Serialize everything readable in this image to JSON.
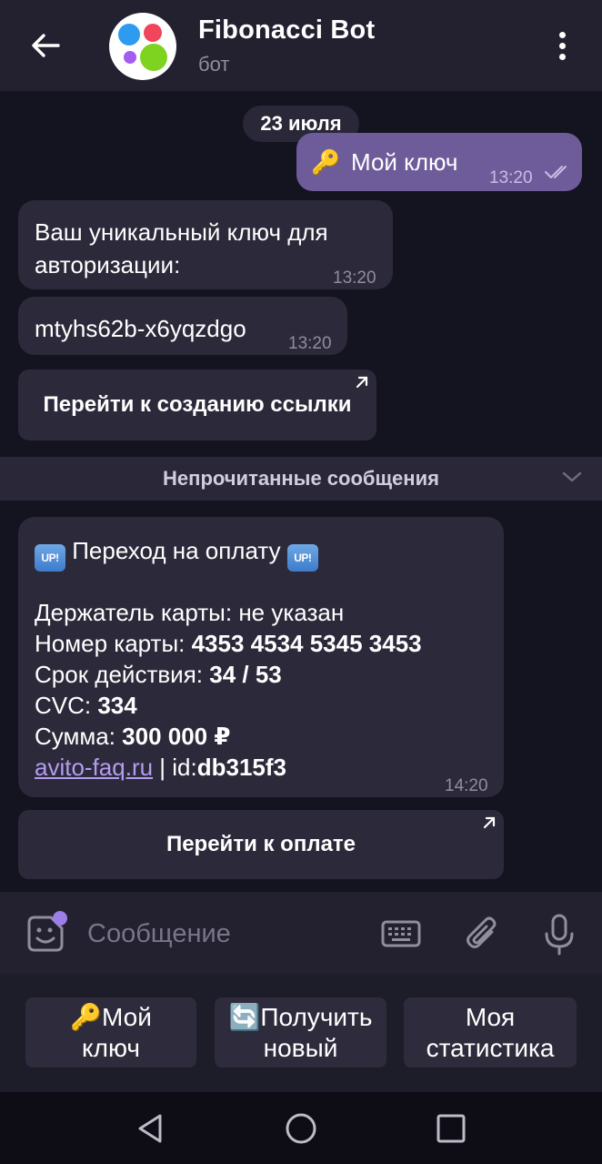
{
  "header": {
    "title": "Fibonacci Bot",
    "subtitle": "бот",
    "avatar_dot_colors": [
      "#2d9bf0",
      "#f0455a",
      "#a55cf0",
      "#7ed321"
    ]
  },
  "chat": {
    "date": "23 июля",
    "outgoing": {
      "emoji": "🔑",
      "text": "Мой ключ",
      "time": "13:20"
    },
    "key_intro": {
      "line1": "Ваш уникальный ключ для",
      "line2": "авторизации:",
      "time": "13:20"
    },
    "key_value": {
      "text": "mtyhs62b-x6yqzdgo",
      "time": "13:20"
    },
    "create_link_button": "Перейти к созданию ссылки",
    "unread_label": "Непрочитанные сообщения",
    "payment": {
      "badge": "UP!",
      "title": "Переход на оплату",
      "holder_label": "Держатель карты: ",
      "holder_value": "не указан",
      "card_label": "Номер карты: ",
      "card_value": "4353 4534 5345 3453",
      "expiry_label": "Срок действия: ",
      "expiry_value": "34 / 53",
      "cvc_label": "CVC: ",
      "cvc_value": "334",
      "sum_label": "Сумма: ",
      "sum_value": "300 000 ₽",
      "link": "avito-faq.ru",
      "id_sep": " | id:",
      "id_value": "db315f3",
      "time": "14:20"
    },
    "pay_button": "Перейти к оплате"
  },
  "input": {
    "placeholder": "Сообщение"
  },
  "reply_keyboard": {
    "key1_emoji": "🔑",
    "key1_line1": "Мой",
    "key1_line2": "ключ",
    "key2_emoji": "🔄",
    "key2_line1": "Получить",
    "key2_line2": "новый",
    "key3_line1": "Моя",
    "key3_line2": "статистика"
  },
  "colors": {
    "accent": "#6e5c9a",
    "link": "#b49cf0",
    "bubble": "#2c2a3a"
  }
}
